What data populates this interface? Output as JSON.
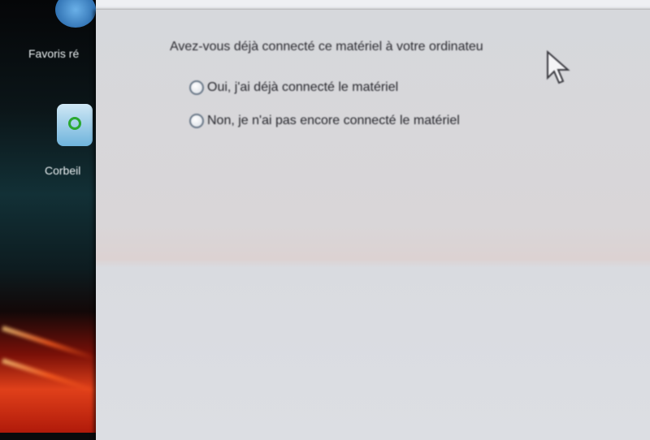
{
  "desktop": {
    "icons": [
      {
        "label": "Favoris ré",
        "icon": "favorites-icon"
      },
      {
        "label": "Corbeil",
        "icon": "recycle-bin-icon"
      }
    ]
  },
  "wizard": {
    "question": "Avez-vous déjà connecté ce matériel à votre ordinateu",
    "options": [
      {
        "label": "Oui, j'ai déjà connecté le matériel",
        "selected": false
      },
      {
        "label": "Non, je n'ai pas encore connecté le matériel",
        "selected": false
      }
    ]
  }
}
